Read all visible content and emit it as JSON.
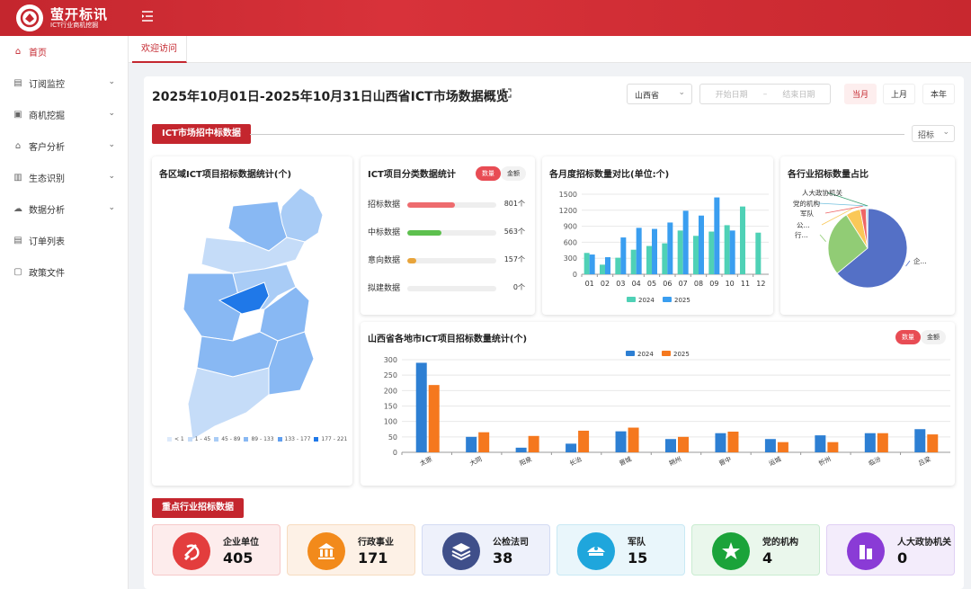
{
  "app": {
    "name": "萤开标讯",
    "sub": "ICT行业商机挖掘"
  },
  "sidebar": {
    "items": [
      {
        "label": "首页",
        "icon": "home-icon",
        "active": true,
        "expand": false
      },
      {
        "label": "订阅监控",
        "icon": "subscribe-icon",
        "active": false,
        "expand": true
      },
      {
        "label": "商机挖掘",
        "icon": "opportunity-icon",
        "active": false,
        "expand": true
      },
      {
        "label": "客户分析",
        "icon": "customer-icon",
        "active": false,
        "expand": true
      },
      {
        "label": "生态识别",
        "icon": "ecosystem-icon",
        "active": false,
        "expand": true
      },
      {
        "label": "数据分析",
        "icon": "data-analysis-icon",
        "active": false,
        "expand": true
      },
      {
        "label": "订单列表",
        "icon": "order-list-icon",
        "active": false,
        "expand": false
      },
      {
        "label": "政策文件",
        "icon": "policy-file-icon",
        "active": false,
        "expand": false
      }
    ]
  },
  "tabs": {
    "welcome": "欢迎访问"
  },
  "header": {
    "title": "2025年10月01日-2025年10月31日山西省ICT市场数据概览",
    "province": "山西省",
    "start_placeholder": "开始日期",
    "range_sep": "–",
    "end_placeholder": "结束日期",
    "period_buttons": [
      "当月",
      "上月",
      "本年"
    ]
  },
  "section1": {
    "title": "ICT市场招中标数据",
    "filter": "招标"
  },
  "map_card": {
    "title": "各区域ICT项目招标数据统计(个)",
    "legend": [
      {
        "label": "< 1",
        "color": "#ddeafb"
      },
      {
        "label": "1 - 45",
        "color": "#c5dcf8"
      },
      {
        "label": "45 - 89",
        "color": "#a9ccf6"
      },
      {
        "label": "89 - 133",
        "color": "#88b8f3"
      },
      {
        "label": "133 - 177",
        "color": "#5f9ff0"
      },
      {
        "label": "177 - 221",
        "color": "#1f78e8"
      }
    ]
  },
  "category_card": {
    "title": "ICT项目分类数据统计",
    "toggle_on": "数量",
    "toggle_off": "金额",
    "items": [
      {
        "label": "招标数据",
        "value": 801,
        "display": "801个",
        "color": "#ee6b6e",
        "fill": 0.54
      },
      {
        "label": "中标数据",
        "value": 563,
        "display": "563个",
        "color": "#5dc04e",
        "fill": 0.38
      },
      {
        "label": "意向数据",
        "value": 157,
        "display": "157个",
        "color": "#e8a43a",
        "fill": 0.1
      },
      {
        "label": "拟建数据",
        "value": 0,
        "display": "0个",
        "color": "#cccccc",
        "fill": 0
      }
    ]
  },
  "monthly_card": {
    "title": "各月度招标数量对比(单位:个)"
  },
  "pie_card": {
    "title": "各行业招标数量占比",
    "labels": [
      "人大政协机关",
      "党的机构",
      "军队",
      "公...",
      "行...",
      "企..."
    ]
  },
  "city_card": {
    "title": "山西省各地市ICT项目招标数量统计(个)",
    "toggle_on": "数量",
    "toggle_off": "金额"
  },
  "section2": {
    "title": "重点行业招标数据"
  },
  "kpis": [
    {
      "name": "企业单位",
      "value": "405",
      "icon": "party-emblem-icon",
      "bg": "#fdecec",
      "border": "#f6c9c9",
      "circle": "#e33d3d"
    },
    {
      "name": "行政事业",
      "value": "171",
      "icon": "government-building-icon",
      "bg": "#fdf1e6",
      "border": "#f7dcc0",
      "circle": "#f28a1b"
    },
    {
      "name": "公检法司",
      "value": "38",
      "icon": "police-badge-icon",
      "bg": "#eef1fb",
      "border": "#d3dbf3",
      "circle": "#3f4f8a"
    },
    {
      "name": "军队",
      "value": "15",
      "icon": "military-cap-icon",
      "bg": "#e9f6fb",
      "border": "#c9e9f4",
      "circle": "#1fa6dc"
    },
    {
      "name": "党的机构",
      "value": "4",
      "icon": "party-star-icon",
      "bg": "#eaf7ec",
      "border": "#c9ecd0",
      "circle": "#1ba33a"
    },
    {
      "name": "人大政协机关",
      "value": "0",
      "icon": "congress-building-icon",
      "bg": "#f3ecfb",
      "border": "#e0d0f4",
      "circle": "#8a3bd6"
    }
  ],
  "chart_data": [
    {
      "type": "bar",
      "title": "各月度招标数量对比(单位:个)",
      "categories": [
        "01",
        "02",
        "03",
        "04",
        "05",
        "06",
        "07",
        "08",
        "09",
        "10",
        "11",
        "12"
      ],
      "series": [
        {
          "name": "2024",
          "color": "#4fd1b6",
          "values": [
            400,
            180,
            310,
            460,
            530,
            580,
            820,
            720,
            800,
            920,
            1270,
            780
          ]
        },
        {
          "name": "2025",
          "color": "#3a9ef0",
          "values": [
            370,
            320,
            690,
            870,
            850,
            970,
            1190,
            1100,
            1440,
            820,
            0,
            0
          ]
        }
      ],
      "yticks": [
        0,
        300,
        600,
        900,
        1200,
        1500
      ],
      "ylim": [
        0,
        1500
      ]
    },
    {
      "type": "pie",
      "title": "各行业招标数量占比",
      "slices": [
        {
          "label": "企...",
          "value": 405,
          "color": "#5470c6"
        },
        {
          "label": "行...",
          "value": 171,
          "color": "#91cc75"
        },
        {
          "label": "公...",
          "value": 38,
          "color": "#fac858"
        },
        {
          "label": "军队",
          "value": 15,
          "color": "#ee6666"
        },
        {
          "label": "党的机构",
          "value": 4,
          "color": "#73c0de"
        },
        {
          "label": "人大政协机关",
          "value": 0,
          "color": "#3ba272"
        }
      ]
    },
    {
      "type": "bar",
      "title": "山西省各地市ICT项目招标数量统计(个)",
      "categories": [
        "太原",
        "大同",
        "阳泉",
        "长治",
        "晋城",
        "朔州",
        "晋中",
        "运城",
        "忻州",
        "临汾",
        "吕梁"
      ],
      "series": [
        {
          "name": "2024",
          "color": "#2d7fd3",
          "values": [
            290,
            50,
            15,
            28,
            68,
            43,
            62,
            43,
            55,
            62,
            75
          ]
        },
        {
          "name": "2025",
          "color": "#f5781e",
          "values": [
            218,
            65,
            53,
            70,
            80,
            50,
            67,
            33,
            33,
            62,
            58
          ]
        }
      ],
      "yticks": [
        0,
        50,
        100,
        150,
        200,
        250,
        300
      ],
      "ylim": [
        0,
        300
      ]
    }
  ]
}
